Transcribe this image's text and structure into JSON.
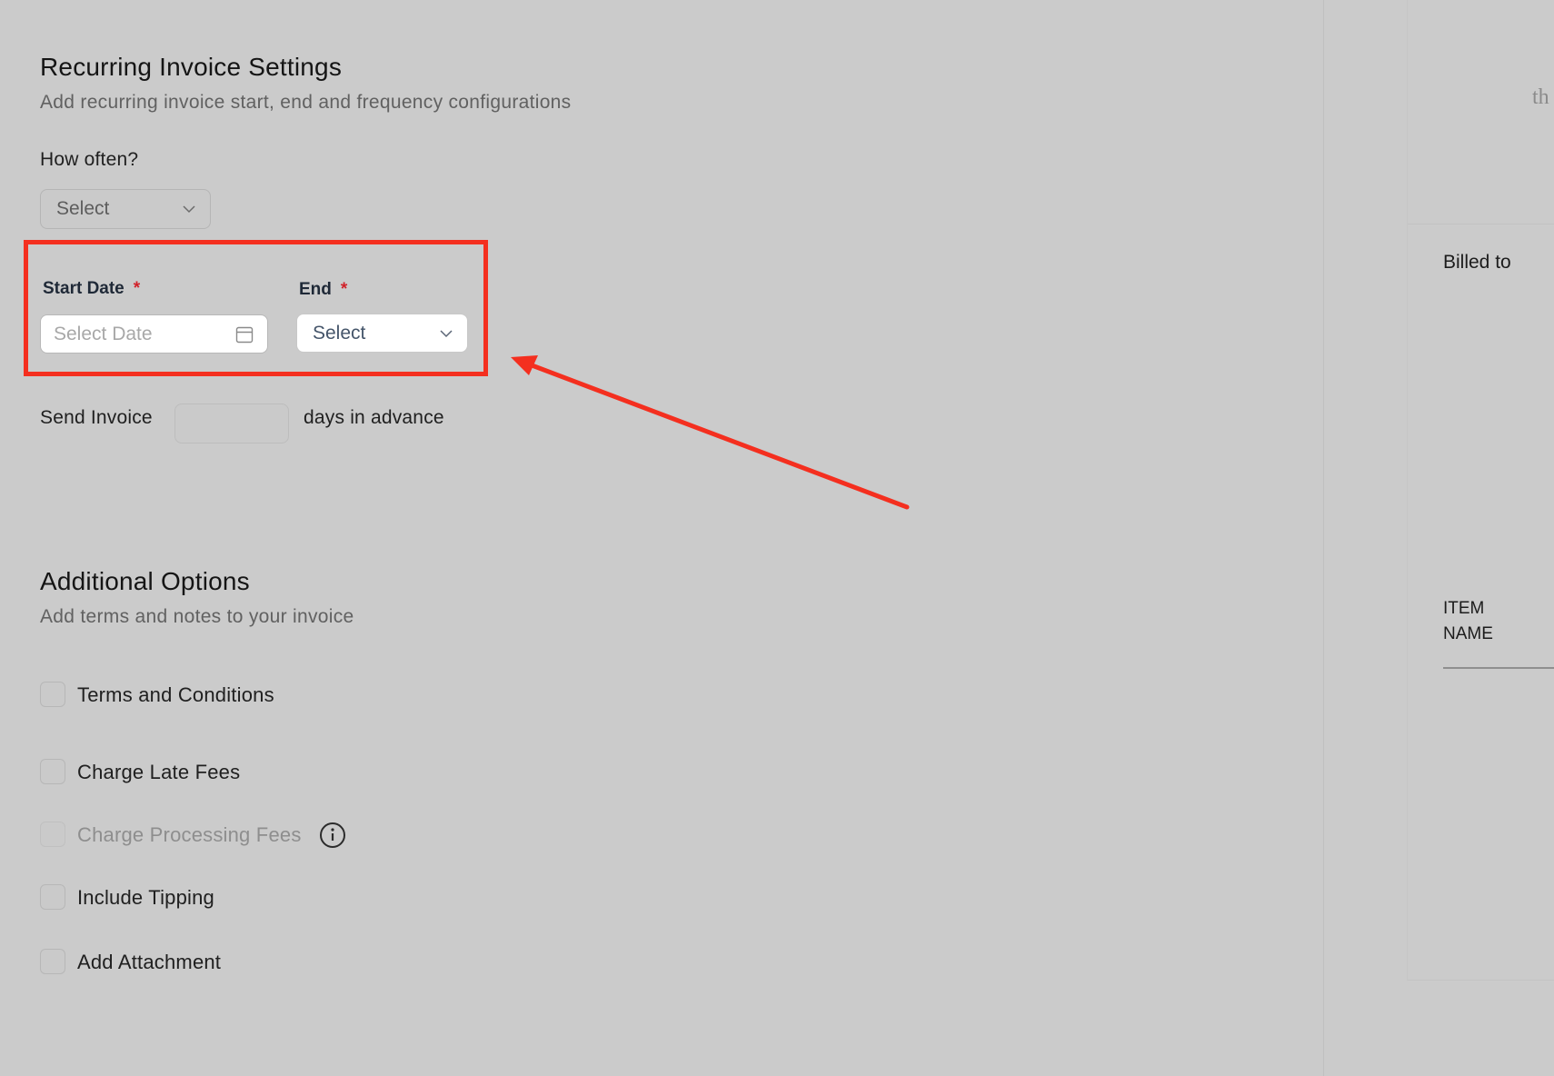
{
  "recurring": {
    "title": "Recurring Invoice Settings",
    "subtitle": "Add recurring invoice start, end and frequency configurations",
    "how_often_label": "How often?",
    "how_often_value": "Select",
    "start_date_label": "Start Date",
    "start_date_required": "*",
    "start_date_placeholder": "Select Date",
    "end_label": "End",
    "end_required": "*",
    "end_value": "Select",
    "send_invoice_label": "Send Invoice",
    "days_in_advance_label": "days in advance",
    "days_value": ""
  },
  "additional": {
    "title": "Additional Options",
    "subtitle": "Add terms and notes to your invoice",
    "options": [
      {
        "label": "Terms and Conditions",
        "enabled": true,
        "checked": false
      },
      {
        "label": "Charge Late Fees",
        "enabled": true,
        "checked": false
      },
      {
        "label": "Charge Processing Fees",
        "enabled": false,
        "checked": false
      },
      {
        "label": "Include Tipping",
        "enabled": true,
        "checked": false
      },
      {
        "label": "Add Attachment",
        "enabled": true,
        "checked": false
      }
    ]
  },
  "preview": {
    "partial_text": "th",
    "billed_to": "Billed to",
    "item_name_line1": "ITEM",
    "item_name_line2": "NAME"
  },
  "icons": {
    "chevron": "chevron-down-icon",
    "calendar": "calendar-icon",
    "info": "info-icon"
  },
  "colors": {
    "overlay_bg": "#cbcbcb",
    "annotation_red": "#f42f1f",
    "required_red": "#d1222a"
  }
}
